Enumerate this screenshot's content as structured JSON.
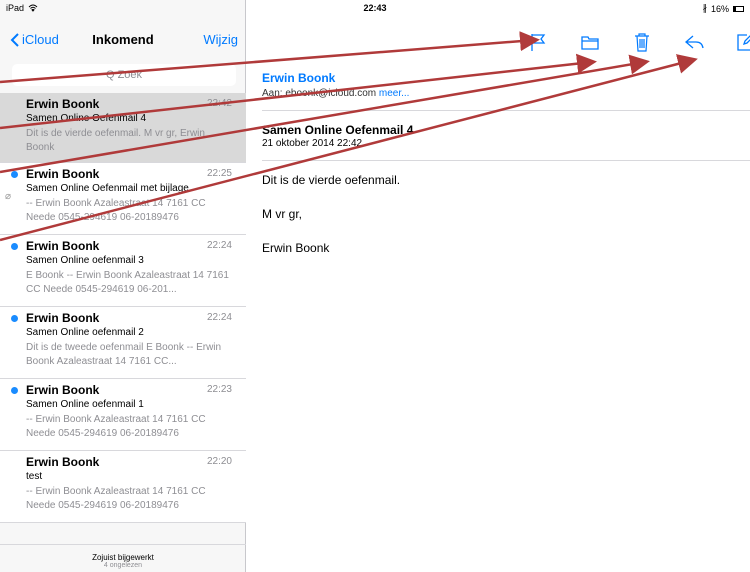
{
  "status": {
    "device": "iPad",
    "time": "22:43",
    "battery": "16%"
  },
  "nav": {
    "back": "iCloud",
    "title": "Inkomend",
    "edit": "Wijzig"
  },
  "search": {
    "placeholder": "Q Zoek"
  },
  "messages": [
    {
      "sender": "Erwin Boonk",
      "time": "22:42",
      "subject": "Samen Online Oefenmail 4",
      "preview": "Dit is de vierde oefenmail. M vr gr, Erwin Boonk",
      "unread": false,
      "selected": true
    },
    {
      "sender": "Erwin Boonk",
      "time": "22:25",
      "subject": "Samen Online Oefenmail met bijlage",
      "preview": "-- Erwin Boonk Azaleastraat 14 7161 CC Neede 0545-294619 06-20189476",
      "unread": true,
      "attachment": true
    },
    {
      "sender": "Erwin Boonk",
      "time": "22:24",
      "subject": "Samen Online oefenmail 3",
      "preview": "E Boonk -- Erwin Boonk Azaleastraat 14 7161 CC Neede 0545-294619 06-201...",
      "unread": true
    },
    {
      "sender": "Erwin Boonk",
      "time": "22:24",
      "subject": "Samen Online oefenmail 2",
      "preview": "Dit is de tweede oefenmail E Boonk -- Erwin Boonk Azaleastraat 14 7161 CC...",
      "unread": true
    },
    {
      "sender": "Erwin Boonk",
      "time": "22:23",
      "subject": "Samen Online oefenmail 1",
      "preview": "-- Erwin Boonk Azaleastraat 14 7161 CC Neede 0545-294619 06-20189476",
      "unread": true
    },
    {
      "sender": "Erwin Boonk",
      "time": "22:20",
      "subject": "test",
      "preview": "-- Erwin Boonk Azaleastraat 14 7161 CC Neede 0545-294619 06-20189476",
      "unread": false
    }
  ],
  "footer": {
    "updated": "Zojuist bijgewerkt",
    "unread": "4 ongelezen"
  },
  "toolbar": {
    "icons": [
      "flag-icon",
      "folder-icon",
      "trash-icon",
      "reply-icon",
      "compose-icon"
    ],
    "accent": "#007aff"
  },
  "detail": {
    "from": "Erwin Boonk",
    "to": "Aan: eboonk@icloud.com",
    "more": "meer...",
    "subject": "Samen Online Oefenmail 4",
    "date": "21 oktober 2014 22:42",
    "body": [
      "Dit is de vierde oefenmail.",
      "M vr gr,",
      "Erwin Boonk"
    ]
  },
  "annotation_color": "#b03a3a"
}
